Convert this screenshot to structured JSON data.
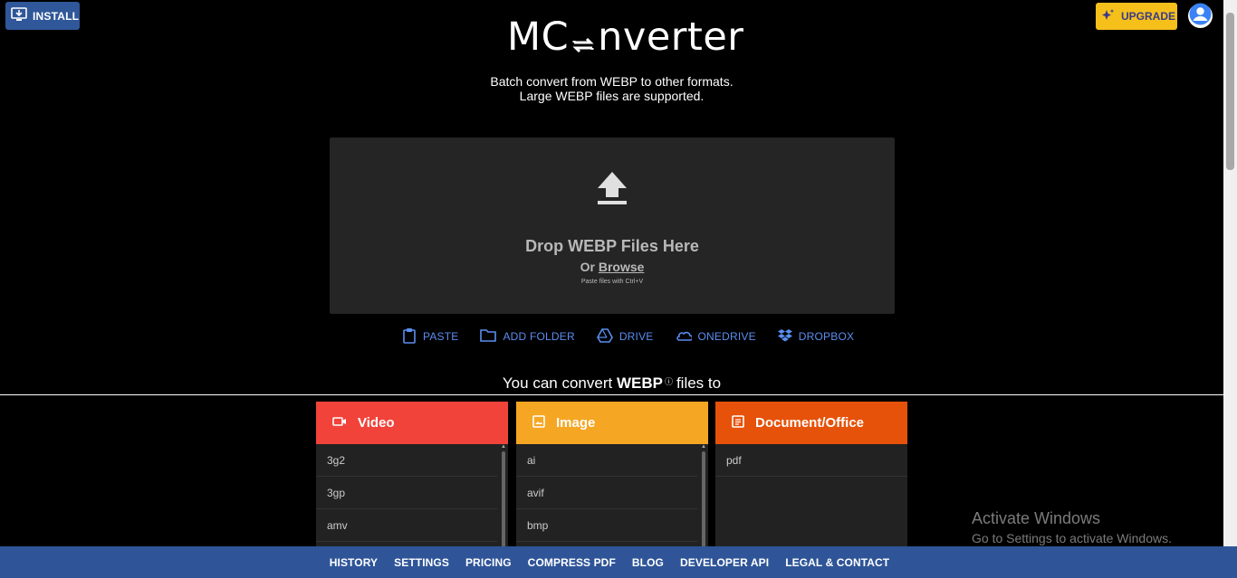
{
  "header": {
    "install_label": "INSTALL",
    "upgrade_label": "UPGRADE",
    "logo_prefix": "MC",
    "logo_suffix": "nverter"
  },
  "intro": {
    "line1": "Batch convert from WEBP to other formats.",
    "line2": "Large WEBP files are supported."
  },
  "dropzone": {
    "title": "Drop WEBP Files Here",
    "or_text": "Or",
    "browse_label": "Browse",
    "paste_hint": "Paste files with Ctrl+V"
  },
  "sources": [
    {
      "label": "PASTE",
      "icon": "clipboard-icon"
    },
    {
      "label": "ADD FOLDER",
      "icon": "folder-icon"
    },
    {
      "label": "DRIVE",
      "icon": "google-drive-icon"
    },
    {
      "label": "ONEDRIVE",
      "icon": "onedrive-icon"
    },
    {
      "label": "DROPBOX",
      "icon": "dropbox-icon"
    }
  ],
  "convert": {
    "prefix": "You can convert",
    "format": "WEBP",
    "info_icon": "ⓘ",
    "suffix": "files to"
  },
  "categories": [
    {
      "name": "Video",
      "color": "#f1433a",
      "icon": "video-camera-icon",
      "items": [
        "3g2",
        "3gp",
        "amv",
        ""
      ]
    },
    {
      "name": "Image",
      "color": "#f5a623",
      "icon": "image-icon",
      "items": [
        "ai",
        "avif",
        "bmp",
        ""
      ]
    },
    {
      "name": "Document/Office",
      "color": "#e6520a",
      "icon": "document-icon",
      "items": [
        "pdf"
      ]
    }
  ],
  "watermark": {
    "line1": "Activate Windows",
    "line2": "Go to Settings to activate Windows."
  },
  "footer": {
    "links": [
      "HISTORY",
      "SETTINGS",
      "PRICING",
      "COMPRESS PDF",
      "BLOG",
      "DEVELOPER API",
      "LEGAL & CONTACT"
    ]
  }
}
